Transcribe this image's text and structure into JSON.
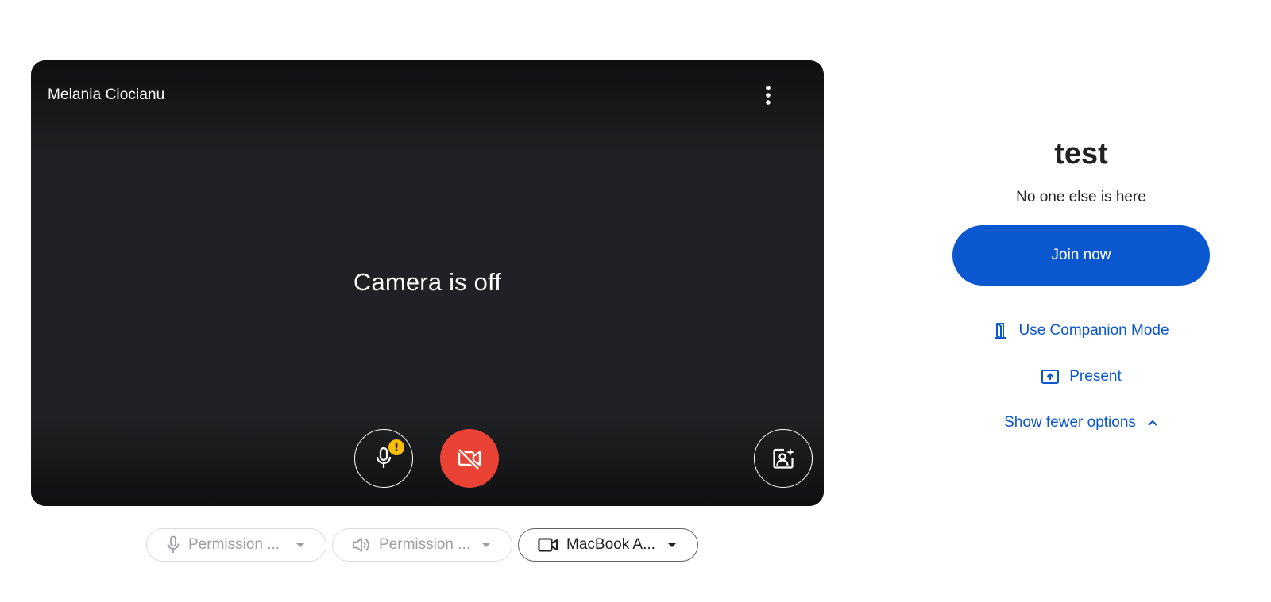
{
  "preview": {
    "participant_name": "Melania Ciocianu",
    "camera_status": "Camera is off"
  },
  "devices": {
    "microphone": "Permission ...",
    "speaker": "Permission ...",
    "camera": "MacBook A..."
  },
  "join": {
    "meeting_title": "test",
    "presence_status": "No one else is here",
    "join_label": "Join now",
    "companion_label": "Use Companion Mode",
    "present_label": "Present",
    "fewer_options_label": "Show fewer options"
  },
  "colors": {
    "primary_blue": "#0b57d0",
    "camera_off_red": "#ea4335",
    "warning_yellow": "#fbbc04",
    "preview_background": "#202124"
  },
  "icons": {
    "more": "more-vert-icon",
    "mic": "mic-icon",
    "mic_warning": "warning-badge-icon",
    "camera_off": "videocam-off-icon",
    "effects": "visual-effects-icon",
    "speaker": "speaker-icon",
    "camera": "videocam-icon",
    "companion": "companion-mode-icon",
    "present": "present-screen-icon",
    "fewer": "chevron-up-icon"
  }
}
